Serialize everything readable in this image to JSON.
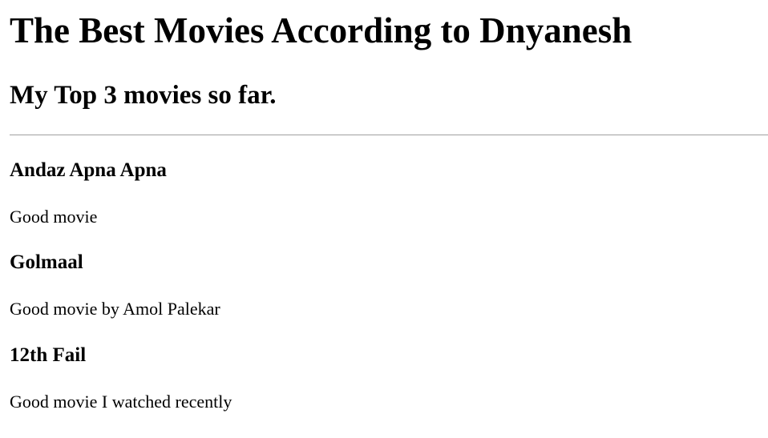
{
  "page": {
    "title": "The Best Movies According to Dnyanesh",
    "subtitle": "My Top 3 movies so far."
  },
  "movies": [
    {
      "title": "Andaz Apna Apna",
      "description": "Good movie"
    },
    {
      "title": "Golmaal",
      "description": "Good movie by Amol Palekar"
    },
    {
      "title": "12th Fail",
      "description": "Good movie I watched recently"
    }
  ]
}
